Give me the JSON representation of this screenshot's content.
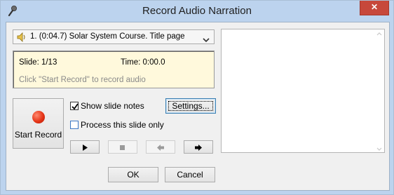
{
  "window": {
    "title": "Record Audio Narration",
    "close_glyph": "✕"
  },
  "icons": {
    "app": "microphone-icon",
    "speaker": "speaker-icon",
    "dropdown": "chevron-down-icon",
    "record": "record-icon",
    "play": "play-icon",
    "stop": "stop-icon",
    "prev": "arrow-left-icon",
    "next": "arrow-right-icon"
  },
  "slide_select": {
    "value": "1. (0:04.7) Solar System Course. Title page"
  },
  "info": {
    "slide": "Slide: 1/13",
    "time": "Time: 0:00.0",
    "hint": "Click \"Start Record\" to record audio"
  },
  "controls": {
    "start_record": "Start Record",
    "show_notes": "Show slide notes",
    "show_notes_checked": true,
    "process_only": "Process this slide only",
    "process_only_checked": false,
    "settings": "Settings..."
  },
  "footer": {
    "ok": "OK",
    "cancel": "Cancel"
  },
  "colors": {
    "titlebar": "#bcd3ee",
    "close": "#c7483b",
    "info_bg": "#fff9dc",
    "record": "#e53417",
    "hint": "#8a8a8a"
  }
}
